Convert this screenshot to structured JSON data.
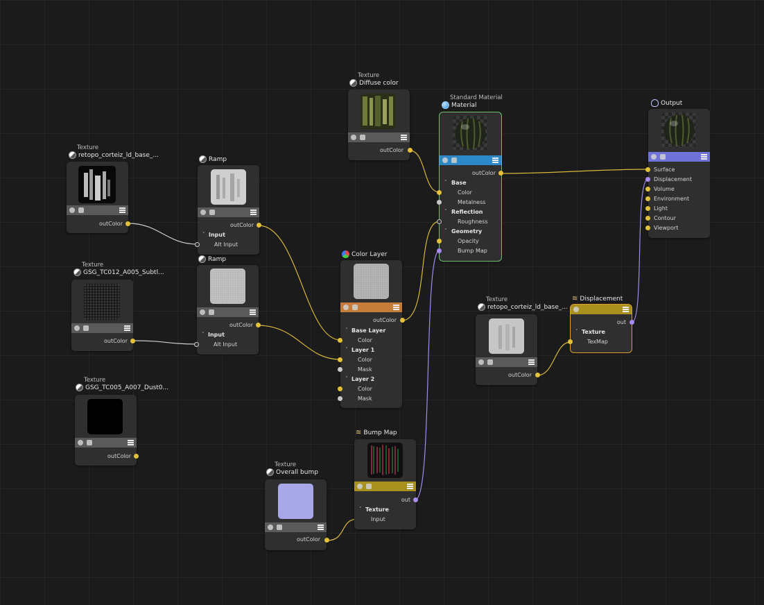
{
  "nodes": {
    "tex1": {
      "sub": "Texture",
      "title": "retopo_corteiz_ld_base_...",
      "out": "outColor"
    },
    "tex2": {
      "sub": "Texture",
      "title": "GSG_TC012_A005_Subtl...",
      "out": "outColor"
    },
    "tex3": {
      "sub": "Texture",
      "title": "GSG_TC005_A007_Dust0...",
      "out": "outColor"
    },
    "ramp1": {
      "title": "Ramp",
      "out": "outColor",
      "group": "Input",
      "in": "Alt Input"
    },
    "ramp2": {
      "title": "Ramp",
      "out": "outColor",
      "group": "Input",
      "in": "Alt Input"
    },
    "diffuse": {
      "sub": "Texture",
      "title": "Diffuse color",
      "out": "outColor"
    },
    "colorlayer": {
      "title": "Color Layer",
      "out": "outColor",
      "groups": [
        {
          "name": "Base Layer",
          "inputs": [
            "Color"
          ]
        },
        {
          "name": "Layer 1",
          "inputs": [
            "Color",
            "Mask"
          ]
        },
        {
          "name": "Layer 2",
          "inputs": [
            "Color",
            "Mask"
          ]
        }
      ]
    },
    "material": {
      "sub": "Standard Material",
      "title": "Material",
      "out": "outColor",
      "groups": [
        {
          "name": "Base",
          "inputs": [
            "Color",
            "Metalness"
          ]
        },
        {
          "name": "Reflection",
          "inputs": [
            "Roughness"
          ]
        },
        {
          "name": "Geometry",
          "inputs": [
            "Opacity",
            "Bump Map"
          ]
        }
      ]
    },
    "output": {
      "title": "Output",
      "inputs": [
        "Surface",
        "Displacement",
        "Volume",
        "Environment",
        "Light",
        "Contour",
        "Viewport"
      ]
    },
    "tex4": {
      "sub": "Texture",
      "title": "retopo_corteiz_ld_base_...",
      "out": "outColor"
    },
    "displacement": {
      "title": "Displacement",
      "out": "out",
      "group": "Texture",
      "in": "TexMap"
    },
    "bump": {
      "sub": "Texture",
      "title": "Overall bump",
      "out": "outColor"
    },
    "bumpmap": {
      "title": "Bump Map",
      "out": "out",
      "group": "Texture",
      "in": "Input"
    }
  },
  "colors": {
    "wire_color": "#d9b93a",
    "wire_white": "#cfcfcf",
    "wire_violet": "#a48af0",
    "bar_gray": "#5a5a5a",
    "bar_material": "#2c88c9",
    "bar_output": "#6f72d6",
    "bar_colorlayer": "#c77d3a",
    "bar_bump": "#a8911f",
    "bar_displacement": "#a8911f"
  }
}
